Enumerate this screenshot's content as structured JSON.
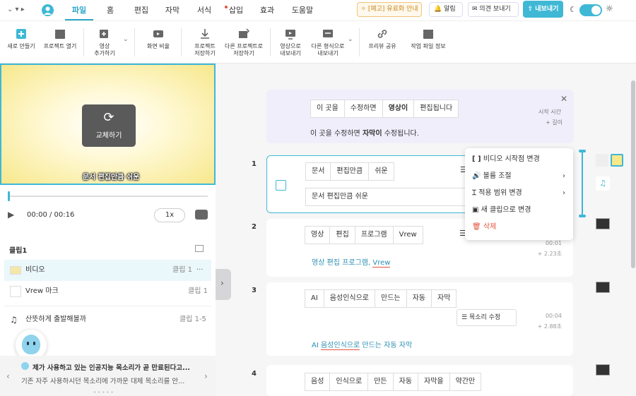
{
  "topbar": {
    "menus": [
      "파일",
      "홈",
      "편집",
      "자막",
      "서식",
      "삽입",
      "효과",
      "도움말"
    ],
    "active_menu": "파일",
    "promo": "[예고] 유료화 안내",
    "alerts": "알림",
    "feedback": "의견 보내기",
    "export": "내보내기"
  },
  "toolbar": {
    "new": "새로 만들기",
    "open": "프로젝트 열기",
    "add_video": [
      "영상",
      "추가하기"
    ],
    "ratio": "화면 비율",
    "save_project": [
      "프로젝트",
      "저장하기"
    ],
    "save_as": [
      "다른 프로젝트로",
      "저장하기"
    ],
    "export_video": [
      "영상으로",
      "내보내기"
    ],
    "export_other": [
      "다른 형식으로",
      "내보내기"
    ],
    "share_preview": "프리뷰 공유",
    "project_info": "작업 파일 정보"
  },
  "preview": {
    "replace_label": "교체하기",
    "caption": "문서 편집만큼 쉬운"
  },
  "player": {
    "time": "00:00 / 00:16",
    "speed": "1x"
  },
  "clips": {
    "title": "클립1",
    "rows": [
      {
        "name": "비디오",
        "clip": "클립 1"
      },
      {
        "name": "Vrew 마크",
        "clip": "클립 1"
      },
      {
        "name": "산뜻하게 출발해볼까",
        "clip": "클립 1-5"
      }
    ]
  },
  "notice": {
    "title": "제가 사용하고 있는 인공지능 목소리가 곧 만료된다고...",
    "body": "기존 자주 사용하시던 목소리에 가까운 대체 목소리를 안..."
  },
  "hint_card": {
    "chips": [
      "이 곳을",
      "수정하면",
      "영상이",
      "편집됩니다"
    ],
    "selected": "영상이",
    "text_before": "이 곳을 수정하면 ",
    "text_bold": "자막이",
    "text_after": " 수정됩니다.",
    "start_time": "시작 시간",
    "length": "+ 길이"
  },
  "segments": [
    {
      "num": "1",
      "chips": [
        "문서",
        "편집만큼",
        "쉬운"
      ],
      "input": "문서 편집만큼 쉬운"
    },
    {
      "num": "2",
      "chips": [
        "영상",
        "편집",
        "프로그램",
        "Vrew"
      ],
      "sentence": [
        "영상",
        "편집",
        "프로그램,",
        "Vrew"
      ],
      "time": "00:01",
      "length": "+ 2.23초"
    },
    {
      "num": "3",
      "chips": [
        "AI",
        "음성인식으로",
        "만드는",
        "자동",
        "자막"
      ],
      "sentence": [
        "AI",
        "음성인식으로",
        "만드는",
        "자동",
        "자막"
      ],
      "voice_btn": "목소리 수정",
      "time": "00:04",
      "length": "+ 2.88초"
    },
    {
      "num": "4",
      "chips": [
        "음성",
        "인식으로",
        "만든",
        "자동",
        "자막을",
        "약간만"
      ]
    }
  ],
  "context_menu": [
    {
      "label": "비디오 시작점 변경",
      "icon": "bracket-icon"
    },
    {
      "label": "볼륨 조절",
      "icon": "volume-icon",
      "submenu": true
    },
    {
      "label": "적용 범위 변경",
      "icon": "range-icon",
      "submenu": true
    },
    {
      "label": "새 클립으로 변경",
      "icon": "new-clip-icon"
    },
    {
      "label": "삭제",
      "icon": "trash-icon"
    }
  ],
  "colors": {
    "accent": "#3fb8d6",
    "hint_bg": "#f1eefc",
    "delete": "#e5533d"
  }
}
